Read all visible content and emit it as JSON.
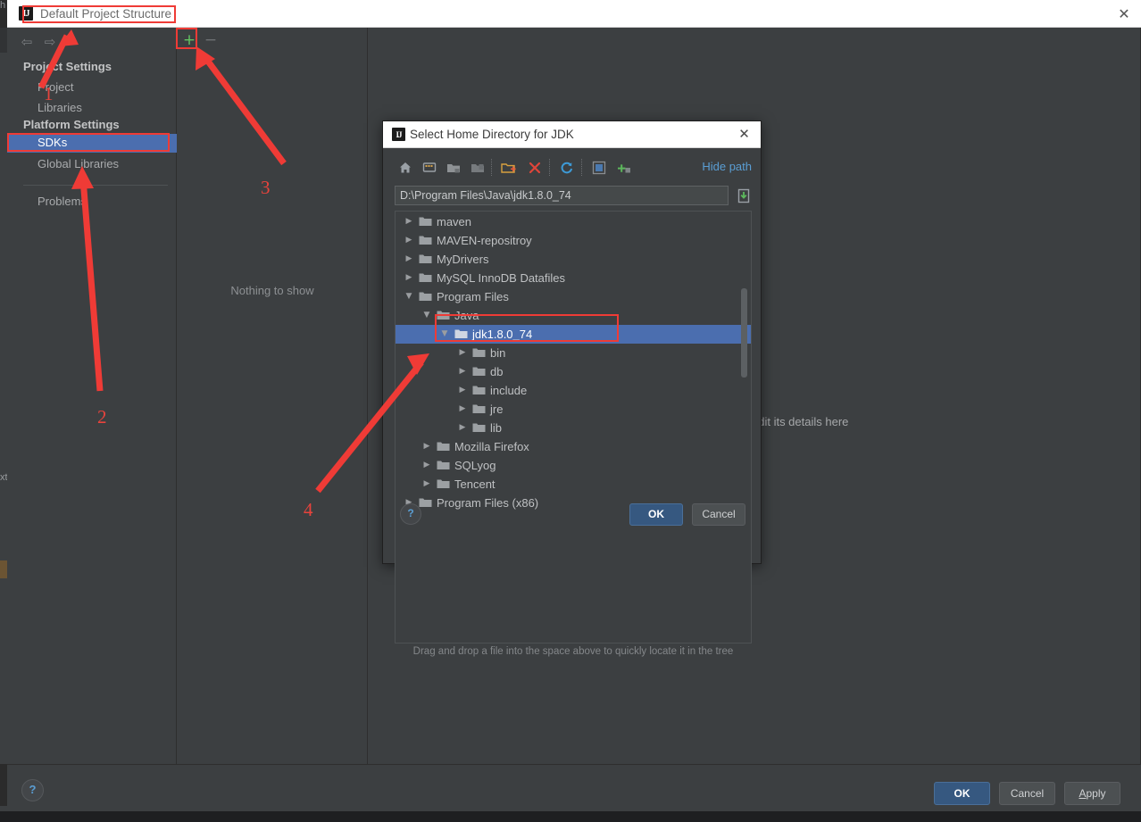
{
  "window": {
    "title": "Default Project Structure",
    "ij_icon_text": "IJ",
    "close_icon": "✕",
    "edge_fragment_top": "h",
    "edge_fragment_mid": "xt"
  },
  "nav": {
    "back_icon": "⇦",
    "forward_icon": "⇨"
  },
  "sidebar": {
    "groups": [
      {
        "label": "Project Settings"
      },
      {
        "label": "Platform Settings"
      }
    ],
    "items": [
      {
        "label": "Project",
        "selected": false
      },
      {
        "label": "Libraries",
        "selected": false
      },
      {
        "label": "SDKs",
        "selected": true
      },
      {
        "label": "Global Libraries",
        "selected": false
      },
      {
        "label": "Problems",
        "selected": false
      }
    ]
  },
  "sdk_panel": {
    "add_icon": "+",
    "remove_icon": "−",
    "empty_text": "Nothing to show"
  },
  "detail_panel": {
    "hint_text": "edit its details here"
  },
  "footer": {
    "help_icon": "?",
    "ok_label": "OK",
    "cancel_label": "Cancel",
    "apply_label_mnemonic": "A",
    "apply_label_rest": "pply"
  },
  "dialog": {
    "title": "Select Home Directory for JDK",
    "ij_icon_text": "IJ",
    "close_icon": "✕",
    "toolbar": {
      "icons": [
        "home-icon",
        "desktop-icon",
        "folder-up-icon",
        "folder-refresh-icon",
        "new-folder-icon",
        "delete-icon",
        "refresh-icon",
        "show-hidden-icon",
        "add-bookmark-icon"
      ],
      "hide_path_label": "Hide path"
    },
    "path_value": "D:\\Program Files\\Java\\jdk1.8.0_74",
    "path_placeholder": "D:\\Program Files\\Java\\jdk1.8.0_74",
    "paste_icon": "paste-icon",
    "tree": [
      {
        "label": "maven",
        "depth": 1,
        "expanded": false,
        "selected": false
      },
      {
        "label": "MAVEN-repositroy",
        "depth": 1,
        "expanded": false,
        "selected": false
      },
      {
        "label": "MyDrivers",
        "depth": 1,
        "expanded": false,
        "selected": false
      },
      {
        "label": "MySQL InnoDB Datafiles",
        "depth": 1,
        "expanded": false,
        "selected": false
      },
      {
        "label": "Program Files",
        "depth": 1,
        "expanded": true,
        "selected": false
      },
      {
        "label": "Java",
        "depth": 2,
        "expanded": true,
        "selected": false
      },
      {
        "label": "jdk1.8.0_74",
        "depth": 3,
        "expanded": true,
        "selected": true
      },
      {
        "label": "bin",
        "depth": 4,
        "expanded": false,
        "selected": false
      },
      {
        "label": "db",
        "depth": 4,
        "expanded": false,
        "selected": false
      },
      {
        "label": "include",
        "depth": 4,
        "expanded": false,
        "selected": false
      },
      {
        "label": "jre",
        "depth": 4,
        "expanded": false,
        "selected": false
      },
      {
        "label": "lib",
        "depth": 4,
        "expanded": false,
        "selected": false
      },
      {
        "label": "Mozilla Firefox",
        "depth": 2,
        "expanded": false,
        "selected": false
      },
      {
        "label": "SQLyog",
        "depth": 2,
        "expanded": false,
        "selected": false
      },
      {
        "label": "Tencent",
        "depth": 2,
        "expanded": false,
        "selected": false
      },
      {
        "label": "Program Files (x86)",
        "depth": 1,
        "expanded": false,
        "selected": false
      }
    ],
    "drag_drop_hint": "Drag and drop a file into the space above to quickly locate it in the tree",
    "help_icon": "?",
    "ok_label": "OK",
    "cancel_label": "Cancel"
  },
  "annotations": {
    "numbers": [
      "1",
      "2",
      "3",
      "4"
    ],
    "color": "#ef3b36",
    "boxes": [
      "title-box",
      "plus-box",
      "sdks-box",
      "jdk-row-box"
    ]
  },
  "colors": {
    "accent_selection": "#4b6eaf",
    "window_bg": "#3c3f41",
    "titlebar_bg": "#ffffff",
    "annotation_red": "#ef3b36",
    "link_blue": "#5a9ed4",
    "add_green": "#62c462",
    "primary_button": "#365880"
  }
}
